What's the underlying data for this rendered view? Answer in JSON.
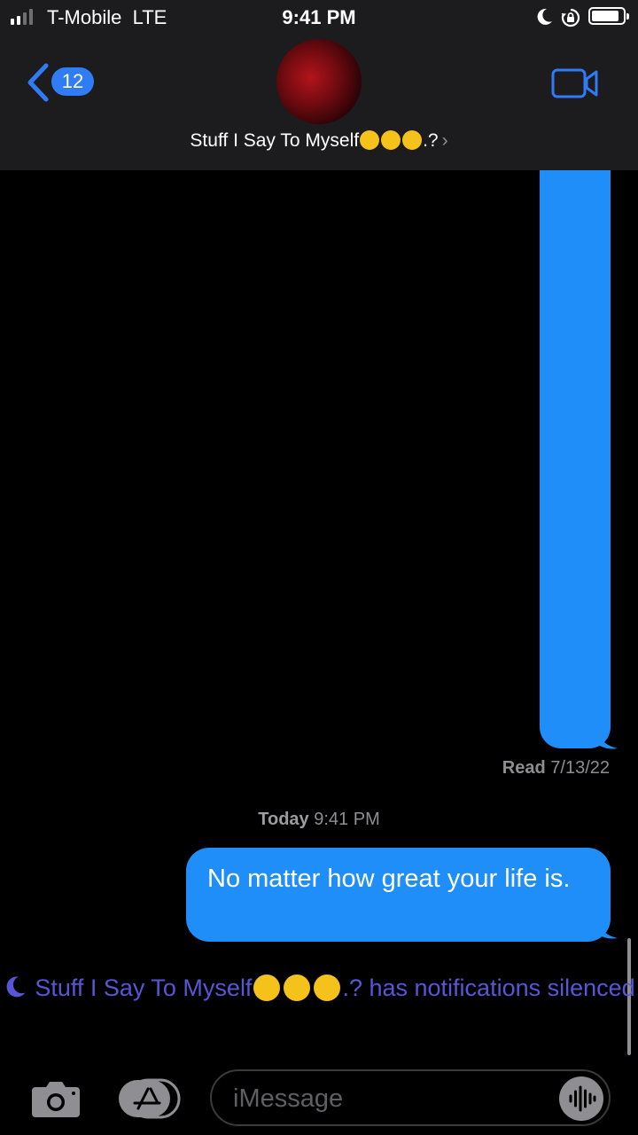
{
  "status_bar": {
    "carrier": "T-Mobile",
    "network": "LTE",
    "time": "9:41 PM",
    "signal_bars_active": 2,
    "signal_bars_total": 4,
    "battery_level": 0.85
  },
  "header": {
    "back_badge": "12",
    "conversation_name": "Stuff I Say To Myself",
    "conversation_suffix": ".?",
    "icons": [
      "back-chevron-icon",
      "avatar",
      "video-camera-icon"
    ]
  },
  "messages": {
    "read_label": "Read",
    "read_date": "7/13/22",
    "timestamp_day": "Today",
    "timestamp_time": "9:41 PM",
    "last_message": "No matter how great your life is."
  },
  "silenced_notice": {
    "name": "Stuff I Say To Myself",
    "suffix": ".?",
    "text": "has notifications silenced"
  },
  "input_bar": {
    "placeholder": "iMessage",
    "icons": [
      "camera-icon",
      "app-store-icon",
      "audio-waveform-icon"
    ]
  },
  "colors": {
    "bubble": "#1f8ef9",
    "accent": "#2f7cf6",
    "silenced_text": "#5856d6",
    "header_bg": "#1c1c1e",
    "secondary_text": "#8e8e93"
  }
}
